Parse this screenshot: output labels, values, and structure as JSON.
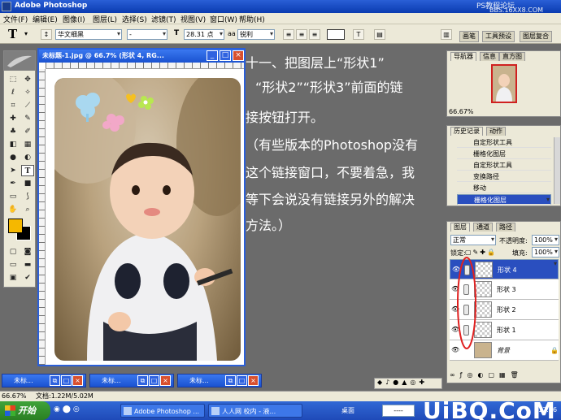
{
  "app": {
    "title": "Adobe Photoshop",
    "watermark_line1": "PS教程论坛",
    "watermark_line2": "BBS.16XX8.COM"
  },
  "menu": [
    "文件(F)",
    "编辑(E)",
    "图像(I)",
    "图层(L)",
    "选择(S)",
    "滤镜(T)",
    "视图(V)",
    "窗口(W)",
    "帮助(H)"
  ],
  "options": {
    "tool_glyph": "T",
    "font_family": "华文细黑",
    "font_style": "-",
    "size_icon": "T",
    "font_size": "28.31 点",
    "aa_prefix": "aa",
    "antialias": "锐利",
    "panel_tabs": [
      "画笔",
      "工具预设",
      "图层复合"
    ]
  },
  "document": {
    "title": "未标题-1.jpg @ 66.7% (形状 4, RG...",
    "btn_min": "_",
    "btn_max": "□",
    "btn_close": "×"
  },
  "overlay_text": [
    "十一、把图层上“形状1”",
    "“形状2”“形状3”前面的链",
    "接按钮打开。",
    "（有些版本的Photoshop没有",
    "这个链接窗口，不要着急，我",
    "等下会说没有链接另外的解决",
    "方法。）"
  ],
  "navigator": {
    "tabs": [
      "导航器",
      "信息",
      "直方图"
    ],
    "zoom": "66.67%"
  },
  "history": {
    "tabs": [
      "历史记录",
      "动作"
    ],
    "items": [
      {
        "label": "自定形状工具",
        "selected": false
      },
      {
        "label": "栅格化图层",
        "selected": false
      },
      {
        "label": "自定形状工具",
        "selected": false
      },
      {
        "label": "变换路径",
        "selected": false
      },
      {
        "label": "移动",
        "selected": false
      },
      {
        "label": "栅格化图层",
        "selected": true
      }
    ]
  },
  "layers": {
    "tabs": [
      "图层",
      "通道",
      "路径"
    ],
    "blend_mode": "正常",
    "opacity_label": "不透明度:",
    "opacity": "100%",
    "lock_label": "锁定:",
    "fill_label": "填充:",
    "fill": "100%",
    "items": [
      {
        "name": "形状 4",
        "selected": true,
        "linked": true
      },
      {
        "name": "形状 3",
        "selected": false,
        "linked": true
      },
      {
        "name": "形状 2",
        "selected": false,
        "linked": true
      },
      {
        "name": "形状 1",
        "selected": false,
        "linked": true
      },
      {
        "name": "背景",
        "selected": false,
        "linked": false
      }
    ],
    "highlight_color": "#e02020"
  },
  "minimized": [
    {
      "title": "未标..."
    },
    {
      "title": "未标..."
    },
    {
      "title": "未标..."
    }
  ],
  "status": {
    "zoom": "66.67%",
    "doc": "文档:1.22M/5.02M"
  },
  "taskbar": {
    "start": "开始",
    "tasks": [
      "Adobe Photoshop ...",
      "人人网 校内 - 液..."
    ],
    "desk": "桌面",
    "time": "17:16",
    "brand": "UiBQ.CoM"
  },
  "colors": {
    "xp_blue": "#2a5fd6",
    "panel_bg": "#ece9d8",
    "selection": "#2a4fbf",
    "foreground_swatch": "#f5b800"
  }
}
